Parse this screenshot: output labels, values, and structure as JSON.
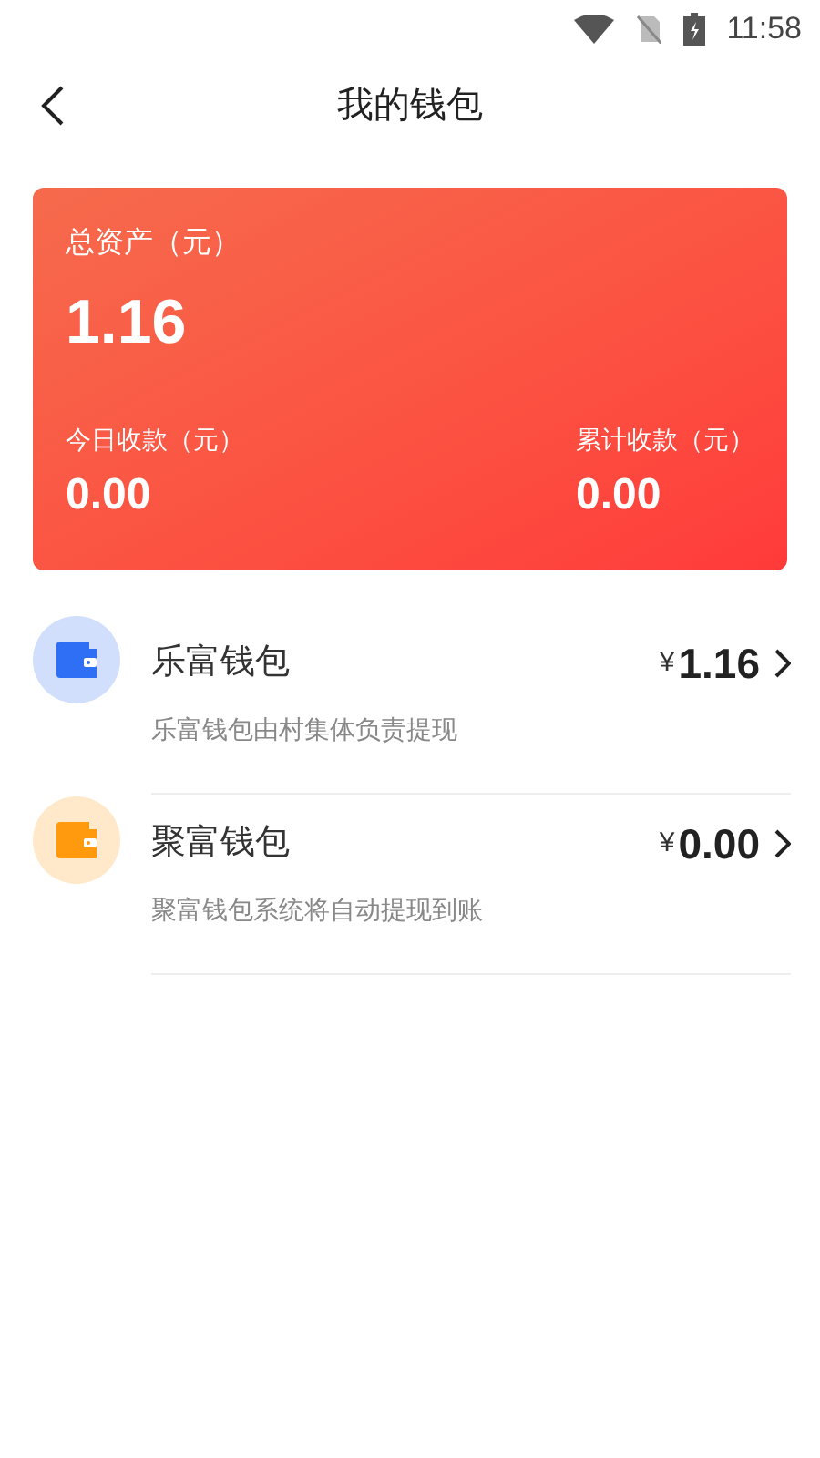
{
  "status_bar": {
    "time": "11:58"
  },
  "header": {
    "title": "我的钱包"
  },
  "summary": {
    "total_label": "总资产（元）",
    "total": "1.16",
    "stats": [
      {
        "label": "今日收款（元）",
        "value": "0.00"
      },
      {
        "label": "累计收款（元）",
        "value": "0.00"
      }
    ]
  },
  "wallets": [
    {
      "name": "乐富钱包",
      "currency": "¥",
      "amount": "1.16",
      "note": "乐富钱包由村集体负责提现",
      "color": "#2f6ff5"
    },
    {
      "name": "聚富钱包",
      "currency": "¥",
      "amount": "0.00",
      "note": "聚富钱包系统将自动提现到账",
      "color": "#ff9a0e"
    }
  ]
}
